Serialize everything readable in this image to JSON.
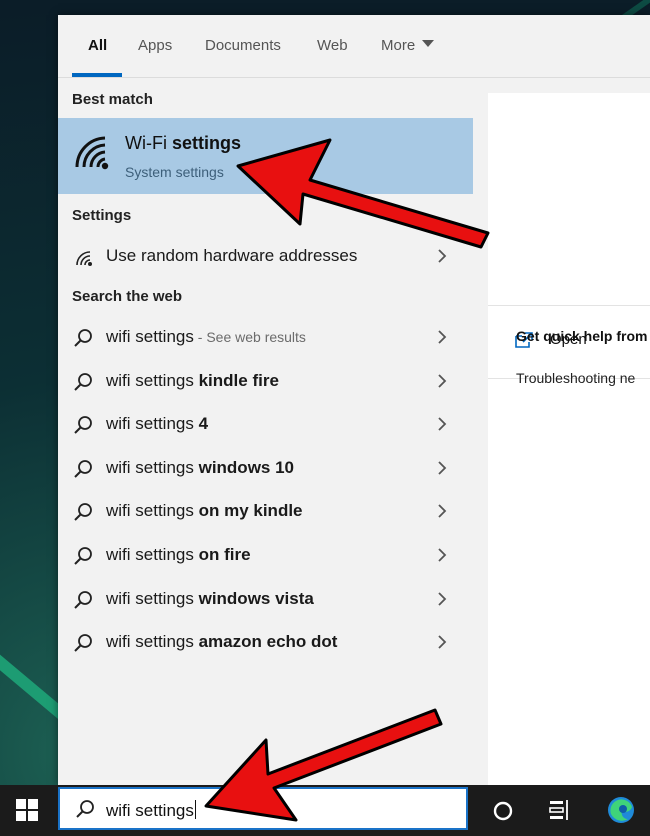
{
  "tabs": [
    {
      "label": "All",
      "active": true
    },
    {
      "label": "Apps"
    },
    {
      "label": "Documents"
    },
    {
      "label": "Web"
    },
    {
      "label": "More"
    }
  ],
  "best_match": {
    "section_title": "Best match",
    "title_prefix": "Wi-Fi",
    "title_bold": " settings",
    "subtitle": "System settings",
    "icon": "wifi-icon"
  },
  "settings_section": {
    "title": "Settings",
    "items": [
      {
        "label": "Use random hardware addresses",
        "icon": "wifi-small-icon"
      }
    ]
  },
  "web_section": {
    "title": "Search the web",
    "items": [
      {
        "prefix": "wifi settings",
        "bold": "",
        "hint": " - See web results"
      },
      {
        "prefix": "wifi settings ",
        "bold": "kindle fire",
        "hint": ""
      },
      {
        "prefix": "wifi settings ",
        "bold": "4",
        "hint": ""
      },
      {
        "prefix": "wifi settings ",
        "bold": "windows 10",
        "hint": ""
      },
      {
        "prefix": "wifi settings ",
        "bold": "on my kindle",
        "hint": ""
      },
      {
        "prefix": "wifi settings ",
        "bold": "on fire",
        "hint": ""
      },
      {
        "prefix": "wifi settings ",
        "bold": "windows vista",
        "hint": ""
      },
      {
        "prefix": "wifi settings ",
        "bold": "amazon echo dot",
        "hint": ""
      }
    ]
  },
  "right_panel": {
    "open_label": "Open",
    "help_title": "Get quick help from",
    "help_item": "Troubleshooting ne"
  },
  "search": {
    "value": "wifi settings"
  },
  "colors": {
    "accent": "#0067c0",
    "selected_bg": "#a8c9e4",
    "arrow": "#e81010"
  }
}
